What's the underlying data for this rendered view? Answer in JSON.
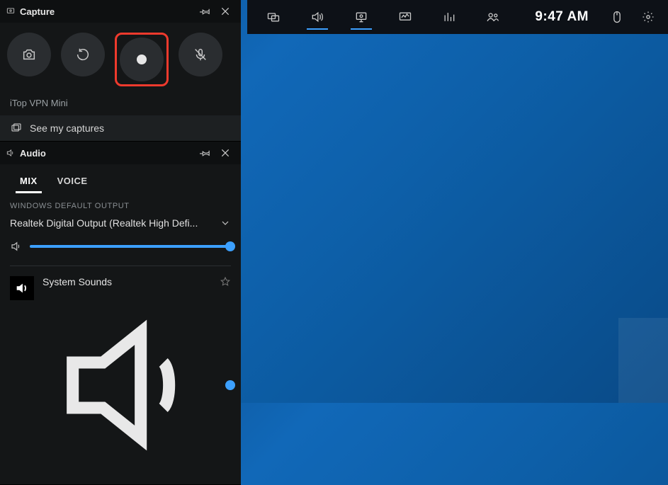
{
  "topbar": {
    "time": "9:47 AM",
    "items": [
      {
        "name": "widgets-icon"
      },
      {
        "name": "audio-icon",
        "active": true
      },
      {
        "name": "capture-icon",
        "active": true
      },
      {
        "name": "performance-icon"
      },
      {
        "name": "resources-icon"
      },
      {
        "name": "xbox-social-icon"
      }
    ],
    "right": [
      {
        "name": "mouse-icon"
      },
      {
        "name": "settings-icon"
      }
    ]
  },
  "capture": {
    "title": "Capture",
    "buttons": {
      "screenshot": "Take screenshot",
      "last30": "Record last 30 seconds",
      "record": "Start recording",
      "mic": "Microphone off"
    },
    "subtitle": "iTop VPN Mini",
    "see_captures": "See my captures"
  },
  "audio": {
    "title": "Audio",
    "tabs": {
      "mix": "MIX",
      "voice": "VOICE"
    },
    "active_tab": "mix",
    "section_label": "WINDOWS DEFAULT OUTPUT",
    "device_name": "Realtek Digital Output (Realtek High Defi...",
    "master_volume_percent": 100,
    "apps": [
      {
        "name": "System Sounds",
        "volume_percent": 100,
        "pinned": false
      }
    ]
  }
}
